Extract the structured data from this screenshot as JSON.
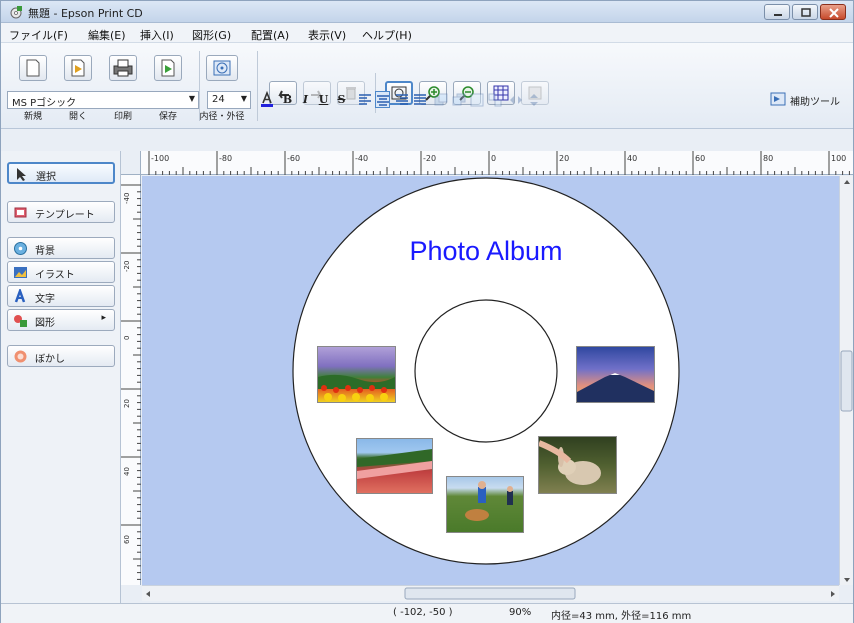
{
  "window": {
    "title": "無題 - Epson Print CD"
  },
  "menu": [
    "ファイル(F)",
    "編集(E)",
    "挿入(I)",
    "図形(G)",
    "配置(A)",
    "表示(V)",
    "ヘルプ(H)"
  ],
  "toolbar": {
    "new_label": "新規",
    "open_label": "開く",
    "print_label": "印刷",
    "save_label": "保存",
    "diameter_label": "内径・外径"
  },
  "format_bar": {
    "font": "MS Pゴシック",
    "size": "24",
    "bold": "B",
    "italic": "I",
    "underline": "U",
    "strike": "S",
    "aux_tool": "補助ツール"
  },
  "left_panel": {
    "select": "選択",
    "template": "テンプレート",
    "background": "背景",
    "illustration": "イラスト",
    "text": "文字",
    "shape": "図形",
    "shape_arrow": "▸",
    "blur": "ぼかし"
  },
  "ruler": {
    "h_ticks": [
      "-100",
      "-80",
      "-60",
      "-40",
      "-20",
      "0",
      "20",
      "40",
      "60",
      "80",
      "100"
    ],
    "v_ticks": [
      "-40",
      "-20",
      "0",
      "20",
      "40",
      "60"
    ]
  },
  "disc": {
    "title": "Photo Album",
    "title_color": "#1a1aff"
  },
  "status": {
    "coords": "( -102, -50 )",
    "zoom": "90%",
    "dimensions": "内径=43 mm, 外径=116 mm"
  },
  "colors": {
    "canvas": "#b5c9f0",
    "accent": "#4d87c9"
  }
}
